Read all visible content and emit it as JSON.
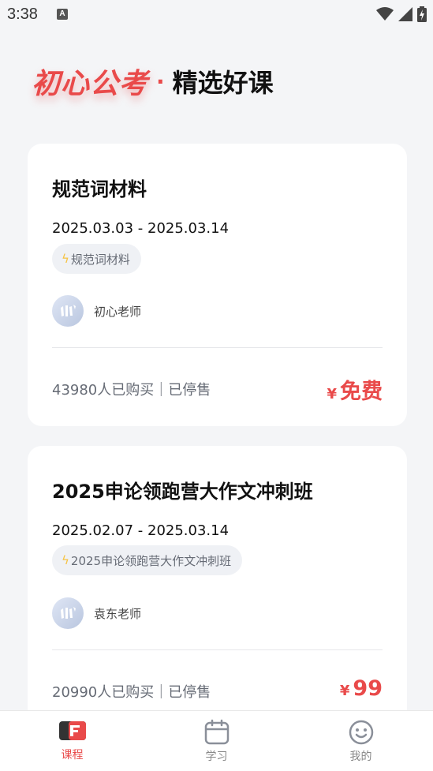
{
  "status_bar": {
    "time": "3:38",
    "a_icon": "A"
  },
  "header": {
    "brand": "初心公考",
    "separator": "·",
    "subtitle": "精选好课"
  },
  "courses": [
    {
      "title": "规范词材料",
      "date_range": "2025.03.03 - 2025.03.14",
      "tag": "规范词材料",
      "teacher": "初心老师",
      "sales": "43980人已购买｜已停售",
      "currency": "¥",
      "price": "免费"
    },
    {
      "title": "2025申论领跑营大作文冲刺班",
      "date_range": "2025.02.07 - 2025.03.14",
      "tag": "2025申论领跑营大作文冲刺班",
      "teacher": "袁东老师",
      "sales": "20990人已购买｜已停售",
      "currency": "¥",
      "price": "99"
    }
  ],
  "nav": [
    {
      "label": "课程",
      "icon": "course-book-icon",
      "active": true
    },
    {
      "label": "学习",
      "icon": "calendar-icon",
      "active": false
    },
    {
      "label": "我的",
      "icon": "smiley-icon",
      "active": false
    }
  ],
  "colors": {
    "accent": "#e94a4a",
    "tag_bg": "#eff1f5",
    "bolt": "#f6c343",
    "page_bg": "#f4f5f7"
  }
}
